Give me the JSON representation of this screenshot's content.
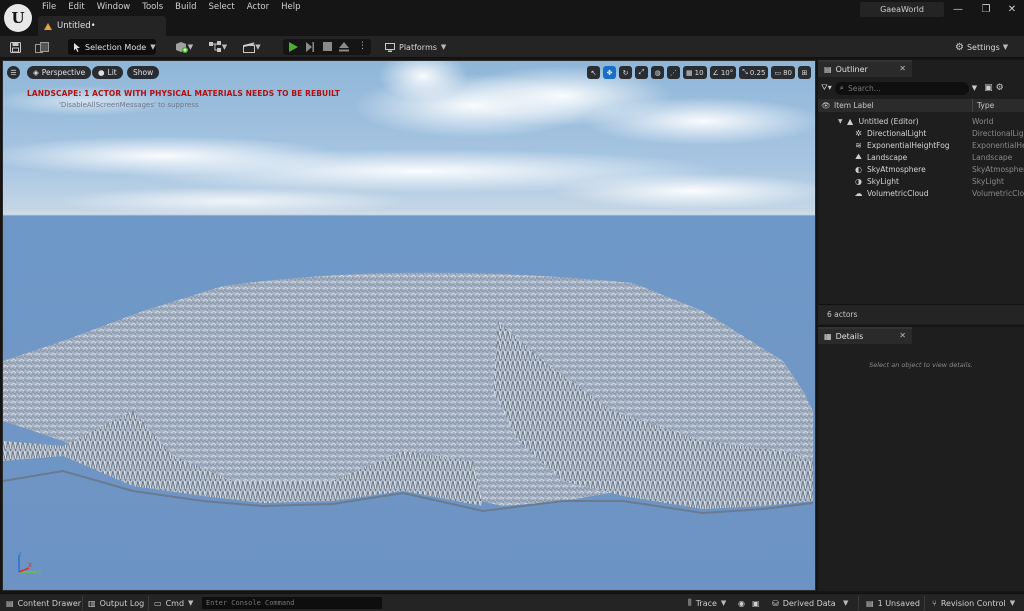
{
  "app": {
    "logo": "U",
    "menu": [
      "File",
      "Edit",
      "Window",
      "Tools",
      "Build",
      "Select",
      "Actor",
      "Help"
    ],
    "document_tab": "Untitled•",
    "project_name": "GaeaWorld",
    "window_controls": {
      "minimize": "—",
      "restore": "❐",
      "close": "✕"
    }
  },
  "toolbar": {
    "mode_label": "Selection Mode",
    "platforms_label": "Platforms",
    "settings_label": "Settings"
  },
  "viewport": {
    "perspective_label": "Perspective",
    "lit_label": "Lit",
    "show_label": "Show",
    "grid_snap": "10",
    "rotation_snap": "10°",
    "scale_snap": "0.25",
    "camera_speed": "80",
    "warning_title": "LANDSCAPE: 1 ACTOR WITH PHYSICAL MATERIALS NEEDS TO BE REBUILT",
    "warning_hint": "'DisableAllScreenMessages' to suppress",
    "gizmo": {
      "z": "Z",
      "x": "X",
      "y": "Y"
    }
  },
  "outliner": {
    "tab_label": "Outliner",
    "search_placeholder": "Search...",
    "col_label": "Item Label",
    "col_type": "Type",
    "root": {
      "label": "Untitled (Editor)",
      "type": "World"
    },
    "items": [
      {
        "label": "DirectionalLight",
        "type": "DirectionalLight",
        "icon": "directional-light-icon"
      },
      {
        "label": "ExponentialHeightFog",
        "type": "ExponentialHeightFog",
        "icon": "fog-icon"
      },
      {
        "label": "Landscape",
        "type": "Landscape",
        "icon": "landscape-icon"
      },
      {
        "label": "SkyAtmosphere",
        "type": "SkyAtmosphere",
        "icon": "sky-atmosphere-icon"
      },
      {
        "label": "SkyLight",
        "type": "SkyLight",
        "icon": "sky-light-icon"
      },
      {
        "label": "VolumetricCloud",
        "type": "VolumetricCloud",
        "icon": "cloud-icon"
      }
    ],
    "actor_count": "6 actors"
  },
  "details": {
    "tab_label": "Details",
    "empty_message": "Select an object to view details."
  },
  "statusbar": {
    "content_drawer": "Content Drawer",
    "output_log": "Output Log",
    "cmd_label": "Cmd",
    "console_placeholder": "Enter Console Command",
    "trace_label": "Trace",
    "derived_data": "Derived Data",
    "unsaved": "1 Unsaved",
    "revision_control": "Revision Control"
  },
  "colors": {
    "accent_blue": "#1a6ec8",
    "play_green": "#4caf2a",
    "warning_red": "#b01010",
    "tab_icon_orange": "#e8a040"
  }
}
